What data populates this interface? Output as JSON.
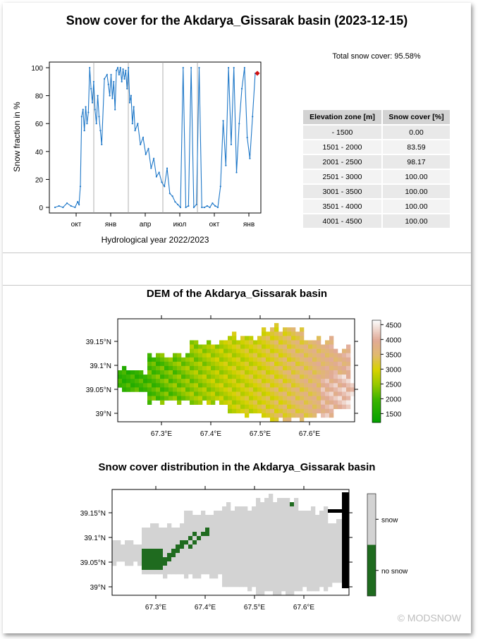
{
  "header": {
    "title": "Snow cover for the Akdarya_Gissarak basin (2023-12-15)",
    "total_snow_cover": "Total snow cover: 95.58%"
  },
  "chart_data": [
    {
      "type": "line",
      "title": "",
      "xlabel": "Hydrological year 2022/2023",
      "ylabel": "Snow fraction in %",
      "ylim": [
        0,
        100
      ],
      "yticks": [
        "0",
        "20",
        "40",
        "60",
        "80",
        "100"
      ],
      "xticks": [
        "окт",
        "янв",
        "апр",
        "июл",
        "окт",
        "янв"
      ],
      "grid": "vertical",
      "series": [
        {
          "color": "#1f78c8",
          "x_month_index": [
            0,
            0.3,
            0.6,
            0.9,
            1.2,
            1.5,
            1.7,
            1.8,
            1.9,
            2.0,
            2.1,
            2.2,
            2.3,
            2.4,
            2.5,
            2.6,
            2.7,
            2.8,
            2.9,
            3.0,
            3.1,
            3.2,
            3.3,
            3.4,
            3.5,
            3.7,
            3.9,
            4.0,
            4.1,
            4.2,
            4.3,
            4.4,
            4.5,
            4.6,
            4.7,
            4.8,
            4.9,
            5.0,
            5.1,
            5.2,
            5.3,
            5.4,
            5.5,
            5.6,
            5.7,
            5.8,
            5.9,
            6.0,
            6.2,
            6.4,
            6.6,
            6.8,
            7.0,
            7.2,
            7.4,
            7.6,
            7.8,
            8.0,
            8.2,
            8.4,
            8.6,
            8.8,
            9.0,
            9.2,
            9.4,
            9.6,
            9.8,
            10.0,
            10.2,
            10.4,
            10.6,
            10.8,
            11.0,
            11.2,
            11.4,
            11.6,
            11.8,
            12.0,
            12.2,
            12.4,
            12.6,
            12.8,
            13.0,
            13.2,
            13.4,
            13.6,
            13.8,
            14.0,
            14.2,
            14.4,
            14.6,
            14.8,
            15.0
          ],
          "values": [
            0,
            1,
            0,
            3,
            1,
            0,
            4,
            2,
            15,
            65,
            70,
            55,
            72,
            60,
            68,
            100,
            85,
            75,
            90,
            70,
            60,
            80,
            65,
            55,
            45,
            92,
            95,
            88,
            80,
            95,
            78,
            90,
            70,
            98,
            100,
            95,
            100,
            90,
            99,
            92,
            98,
            85,
            100,
            75,
            80,
            60,
            72,
            55,
            60,
            45,
            50,
            38,
            42,
            28,
            35,
            22,
            25,
            18,
            15,
            28,
            10,
            8,
            4,
            2,
            0,
            100,
            0,
            1,
            100,
            0,
            2,
            100,
            0,
            0,
            1,
            0,
            3,
            1,
            0,
            15,
            62,
            30,
            100,
            45,
            100,
            25,
            60,
            85,
            100,
            50,
            35,
            65,
            96
          ],
          "last_point": 96
        }
      ]
    },
    {
      "type": "heatmap",
      "title": "DEM of the Akdarya_Gissarak basin",
      "x_ticks": [
        "67.3°E",
        "67.4°E",
        "67.5°E",
        "67.6°E"
      ],
      "y_ticks": [
        "39.15°N",
        "39.1°N",
        "39.05°N",
        "39°N"
      ],
      "colorbar_ticks": [
        "4500",
        "4000",
        "3500",
        "3000",
        "2500",
        "2000",
        "1500"
      ],
      "colorbar_range": [
        1200,
        4650
      ]
    },
    {
      "type": "heatmap",
      "title": "Snow cover distribution in the Akdarya_Gissarak basin",
      "x_ticks": [
        "67.3°E",
        "67.4°E",
        "67.5°E",
        "67.6°E"
      ],
      "y_ticks": [
        "39.15°N",
        "39.1°N",
        "39.05°N",
        "39°N"
      ],
      "legend": [
        "snow",
        "no snow"
      ],
      "colors": {
        "snow": "#d3d3d3",
        "no_snow": "#1f6b1f",
        "other": "#000000"
      }
    }
  ],
  "elevation_table": {
    "headers": [
      "Elevation zone [m]",
      "Snow cover [%]"
    ],
    "rows": [
      [
        "- 1500",
        "0.00"
      ],
      [
        "1501 - 2000",
        "83.59"
      ],
      [
        "2001 - 2500",
        "98.17"
      ],
      [
        "2501 - 3000",
        "100.00"
      ],
      [
        "3001 - 3500",
        "100.00"
      ],
      [
        "3501 - 4000",
        "100.00"
      ],
      [
        "4001 - 4500",
        "100.00"
      ]
    ]
  },
  "footer": {
    "copyright": "© MODSNOW"
  }
}
